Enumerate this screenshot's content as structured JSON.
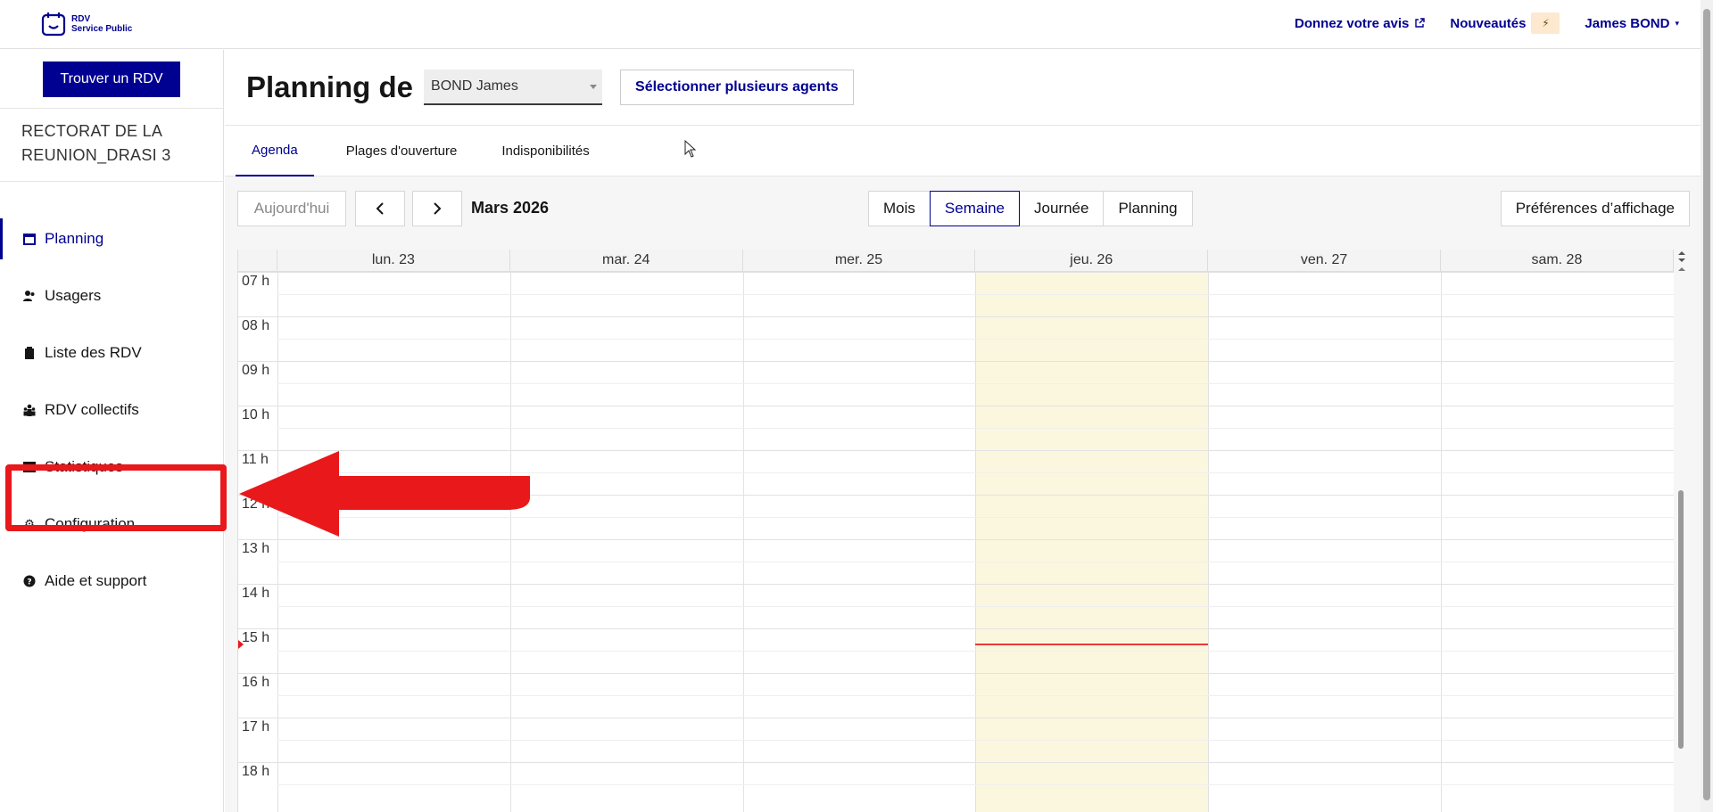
{
  "header": {
    "logo_line1": "RDV",
    "logo_line2": "Service Public",
    "feedback_link": "Donnez votre avis",
    "news_link": "Nouveautés",
    "news_icon": "bolt-icon",
    "user_menu": "James BOND"
  },
  "sidebar": {
    "find_button": "Trouver un RDV",
    "organisation": "RECTORAT DE LA REUNION_DRASI 3",
    "items": [
      {
        "label": "Planning",
        "icon": "calendar-icon",
        "active": true
      },
      {
        "label": "Usagers",
        "icon": "users-icon",
        "active": false
      },
      {
        "label": "Liste des RDV",
        "icon": "clipboard-icon",
        "active": false
      },
      {
        "label": "RDV collectifs",
        "icon": "group-icon",
        "active": false
      },
      {
        "label": "Statistiques",
        "icon": "chart-icon",
        "active": false
      },
      {
        "label": "Configuration",
        "icon": "gear-icon",
        "active": false
      },
      {
        "label": "Aide et support",
        "icon": "help-icon",
        "active": false
      }
    ]
  },
  "main": {
    "title": "Planning de",
    "agent_select_value": "BOND James",
    "multi_agents_button": "Sélectionner plusieurs agents",
    "tabs": [
      {
        "label": "Agenda",
        "active": true
      },
      {
        "label": "Plages d'ouverture",
        "active": false
      },
      {
        "label": "Indisponibilités",
        "active": false
      }
    ]
  },
  "calendar": {
    "today_button": "Aujourd'hui",
    "current_period": "Mars 2026",
    "views": [
      {
        "label": "Mois",
        "active": false
      },
      {
        "label": "Semaine",
        "active": true
      },
      {
        "label": "Journée",
        "active": false
      },
      {
        "label": "Planning",
        "active": false
      }
    ],
    "prefs_button": "Préférences d’affichage",
    "days": [
      "lun. 23",
      "mar. 24",
      "mer. 25",
      "jeu. 26",
      "ven. 27",
      "sam. 28"
    ],
    "today_index": 3,
    "hours": [
      "07 h",
      "08 h",
      "09 h",
      "10 h",
      "11 h",
      "12 h",
      "13 h",
      "14 h",
      "15 h",
      "16 h",
      "17 h",
      "18 h"
    ],
    "now_time": "15:20"
  },
  "colors": {
    "brand": "#000091",
    "annotation_red": "#e8181b",
    "today_column": "#fbf7de"
  }
}
